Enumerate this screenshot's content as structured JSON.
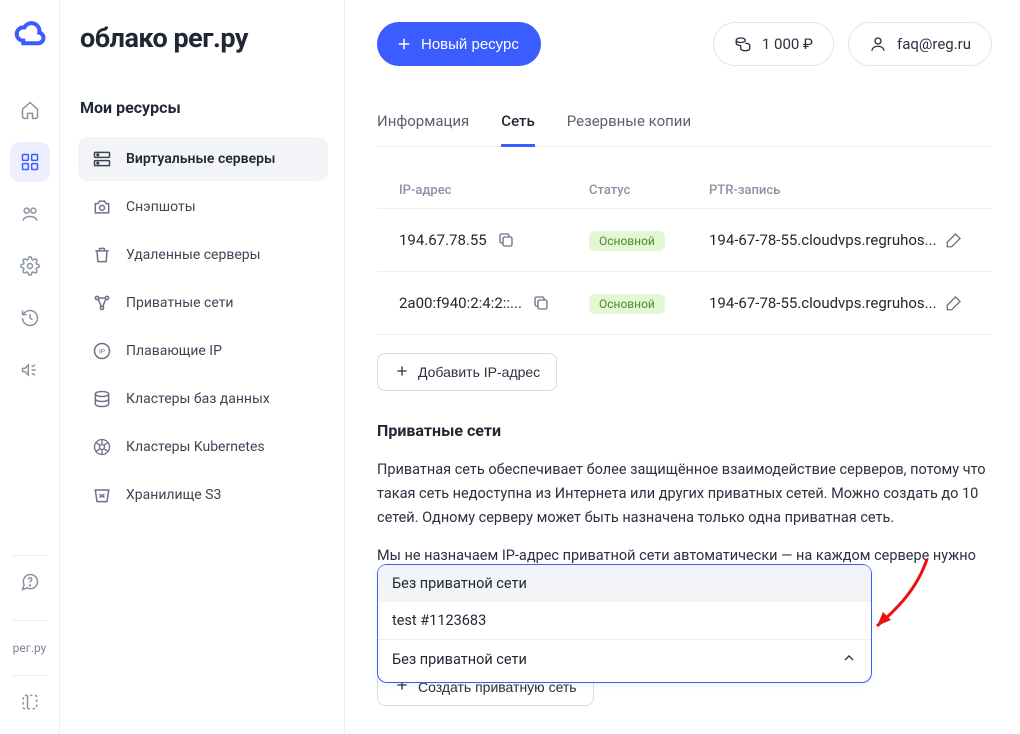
{
  "brand_text": "облако рег.ру",
  "brand_small": "рег.ру",
  "sidebar": {
    "title": "Мои ресурсы",
    "items": [
      {
        "label": "Виртуальные серверы"
      },
      {
        "label": "Снэпшоты"
      },
      {
        "label": "Удаленные серверы"
      },
      {
        "label": "Приватные сети"
      },
      {
        "label": "Плавающие IP"
      },
      {
        "label": "Кластеры баз данных"
      },
      {
        "label": "Кластеры Kubernetes"
      },
      {
        "label": "Хранилище S3"
      }
    ]
  },
  "topbar": {
    "new_resource": "Новый ресурс",
    "balance": "1 000 ₽",
    "account": "faq@reg.ru"
  },
  "tabs": {
    "info": "Информация",
    "network": "Сеть",
    "backup": "Резервные копии"
  },
  "table": {
    "headers": {
      "ip": "IP-адрес",
      "status": "Статус",
      "ptr": "PTR-запись"
    },
    "rows": [
      {
        "ip": "194.67.78.55",
        "status": "Основной",
        "ptr": "194-67-78-55.cloudvps.regruhos..."
      },
      {
        "ip": "2a00:f940:2:4:2::...",
        "status": "Основной",
        "ptr": "194-67-78-55.cloudvps.regruhos..."
      }
    ],
    "add_ip": "Добавить IP-адрес"
  },
  "private": {
    "title": "Приватные сети",
    "desc1": "Приватная сеть обеспечивает более защищённое взаимодействие серверов, потому что такая сеть недоступна из Интернета или других приватных сетей. Можно создать до 10 сетей. Одному серверу может быть назначена только одна приватная сеть.",
    "desc2": "Мы не назначаем IP-адрес приватной сети автоматически — на каждом сервере нужно",
    "dd_options": [
      "Без приватной сети",
      "test #1123683"
    ],
    "dd_value": "Без приватной сети",
    "create": "Создать приватную сеть"
  }
}
